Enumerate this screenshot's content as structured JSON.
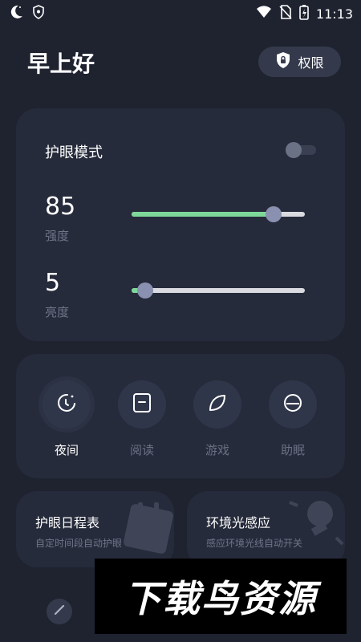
{
  "status_bar": {
    "time": "11:13",
    "icons": [
      "moon-icon",
      "shield-small-icon",
      "wifi-icon",
      "no-sim-icon",
      "battery-charging-icon"
    ]
  },
  "header": {
    "greeting": "早上好",
    "permission_label": "权限",
    "permission_icon": "shield-lock-icon"
  },
  "eye_care": {
    "title": "护眼模式",
    "toggle_on": false,
    "strength": {
      "value": "85",
      "label": "强度",
      "level": 0.82
    },
    "brightness": {
      "value": "5",
      "label": "亮度",
      "level": 0.08
    }
  },
  "modes": [
    {
      "label": "夜间",
      "icon": "moon-clock-icon",
      "active": true
    },
    {
      "label": "阅读",
      "icon": "book-icon",
      "active": false
    },
    {
      "label": "游戏",
      "icon": "leaf-icon",
      "active": false
    },
    {
      "label": "助眠",
      "icon": "sleep-icon",
      "active": false
    }
  ],
  "schedule": {
    "title": "护眼日程表",
    "desc": "自定时间段自动护眼"
  },
  "ambient": {
    "title": "环境光感应",
    "desc": "感应环境光线自动开关"
  },
  "watermark": "下载鸟资源",
  "colors": {
    "background": "#1f2330",
    "card": "#262b3b",
    "accent_green": "#7ed89a",
    "thumb": "#8a90b0"
  }
}
